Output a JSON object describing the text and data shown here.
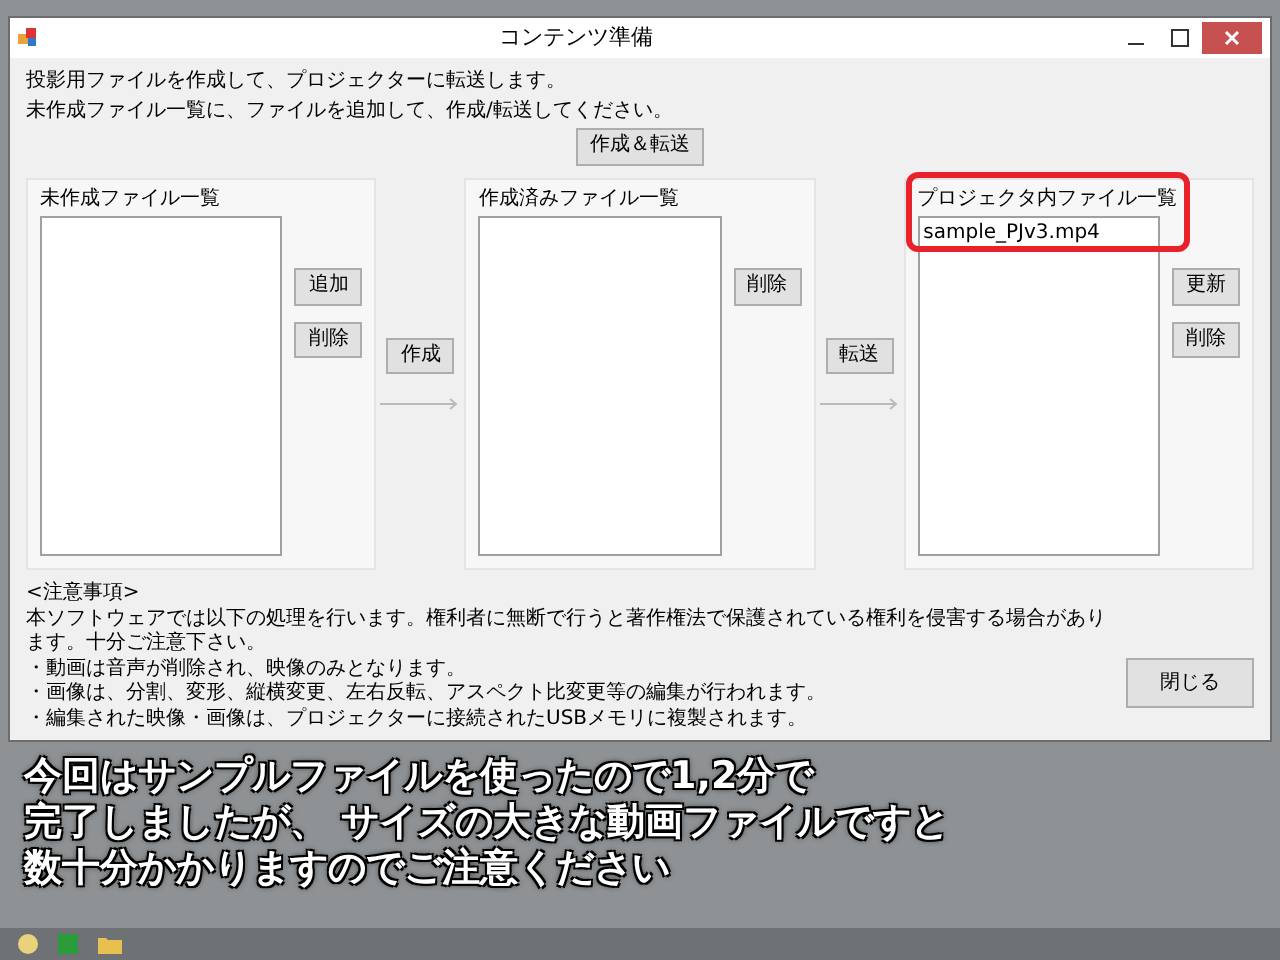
{
  "window": {
    "title": "コンテンツ準備"
  },
  "intro": [
    "投影用ファイルを作成して、プロジェクターに転送します。",
    "未作成ファイル一覧に、ファイルを追加して、作成/転送してください。"
  ],
  "create_transfer_button": "作成＆転送",
  "panels": [
    {
      "label": "未作成ファイル一覧",
      "buttons": [
        "追加",
        "削除"
      ],
      "next_button": "作成"
    },
    {
      "label": "作成済みファイル一覧",
      "buttons": [
        "削除"
      ],
      "next_button": "転送"
    },
    {
      "label": "プロジェクタ内ファイル一覧",
      "items": [
        "sample_PJv3.mp4"
      ],
      "buttons": [
        "更新",
        "削除"
      ],
      "highlighted": true
    }
  ],
  "notes": {
    "heading": "<注意事項>",
    "lines": [
      "本ソフトウェアでは以下の処理を行います。権利者に無断で行うと著作権法で保護されている権利を侵害する場合があります。十分ご注意下さい。",
      "・動画は音声が削除され、映像のみとなります。",
      "・画像は、分割、変形、縦横変更、左右反転、アスペクト比変更等の編集が行われます。",
      "・編集された映像・画像は、プロジェクターに接続されたUSBメモリに複製されます。"
    ]
  },
  "close_button": "閉じる",
  "caption": [
    "今回はサンプルファイルを使ったので1,2分で",
    "完了しましたが、 サイズの大きな動画ファイルですと",
    "数十分かかりますのでご注意ください"
  ]
}
